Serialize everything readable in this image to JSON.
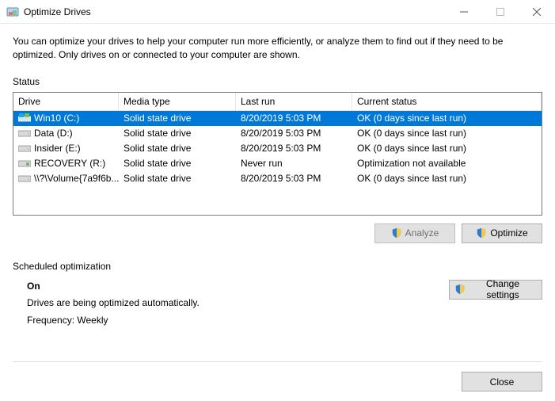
{
  "window": {
    "title": "Optimize Drives"
  },
  "description": "You can optimize your drives to help your computer run more efficiently, or analyze them to find out if they need to be optimized. Only drives on or connected to your computer are shown.",
  "status": {
    "label": "Status",
    "columns": {
      "drive": "Drive",
      "media": "Media type",
      "lastrun": "Last run",
      "status": "Current status"
    },
    "rows": [
      {
        "name": "Win10 (C:)",
        "icon": "os",
        "media": "Solid state drive",
        "lastrun": "8/20/2019 5:03 PM",
        "status": "OK (0 days since last run)",
        "selected": true
      },
      {
        "name": "Data (D:)",
        "icon": "hdd",
        "media": "Solid state drive",
        "lastrun": "8/20/2019 5:03 PM",
        "status": "OK (0 days since last run)",
        "selected": false
      },
      {
        "name": "Insider (E:)",
        "icon": "hdd",
        "media": "Solid state drive",
        "lastrun": "8/20/2019 5:03 PM",
        "status": "OK (0 days since last run)",
        "selected": false
      },
      {
        "name": "RECOVERY (R:)",
        "icon": "rec",
        "media": "Solid state drive",
        "lastrun": "Never run",
        "status": "Optimization not available",
        "selected": false
      },
      {
        "name": "\\\\?\\Volume{7a9f6b...",
        "icon": "hdd",
        "media": "Solid state drive",
        "lastrun": "8/20/2019 5:03 PM",
        "status": "OK (0 days since last run)",
        "selected": false
      }
    ]
  },
  "buttons": {
    "analyze": "Analyze",
    "optimize": "Optimize",
    "change_settings": "Change settings",
    "close": "Close"
  },
  "scheduled": {
    "label": "Scheduled optimization",
    "state": "On",
    "desc": "Drives are being optimized automatically.",
    "freq": "Frequency: Weekly"
  }
}
